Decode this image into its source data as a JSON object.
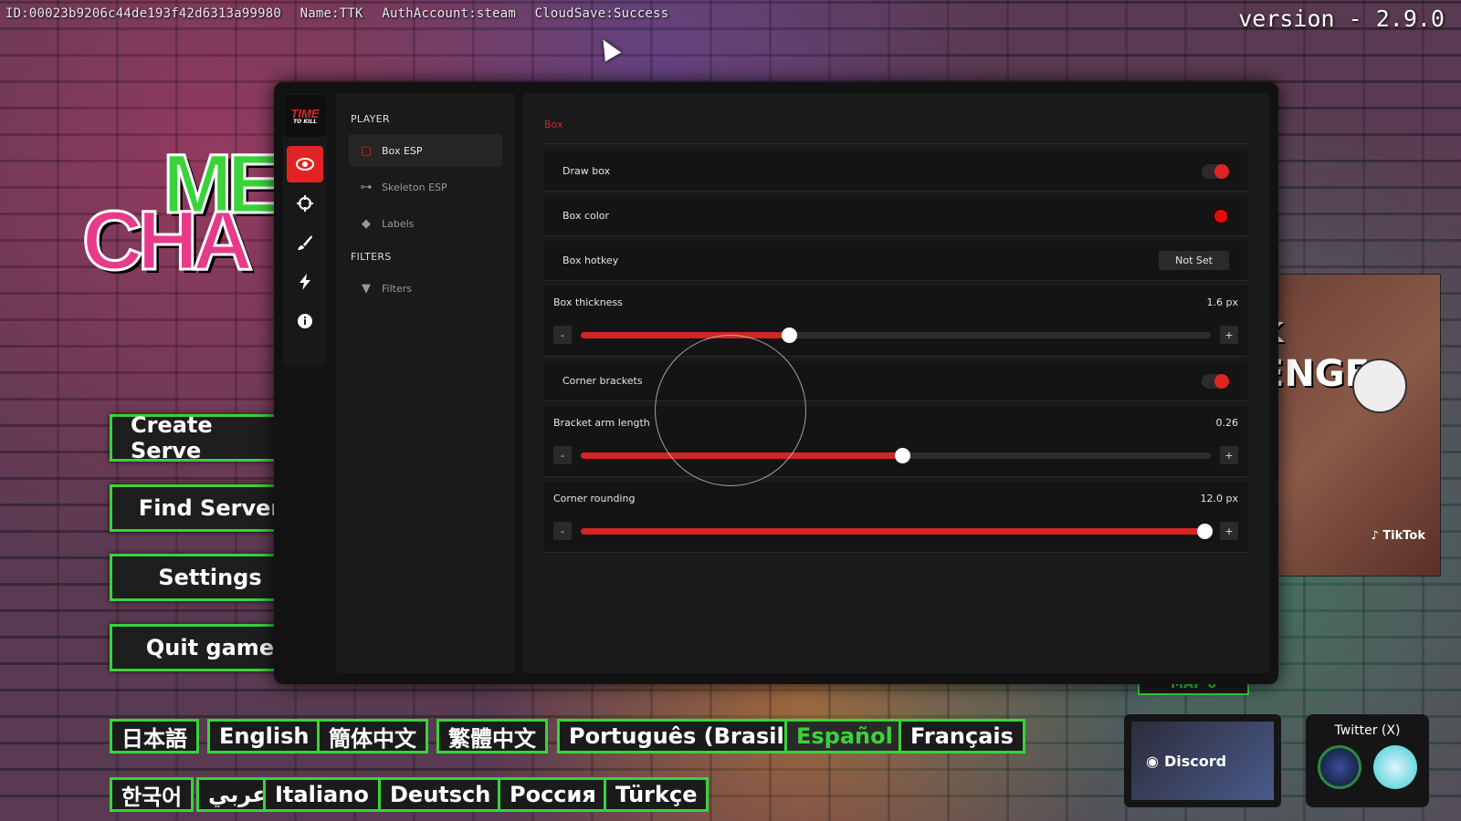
{
  "topbar": {
    "id": "ID:00023b9206c44de193f42d6313a99980",
    "name": "Name:TTK",
    "auth": "AuthAccount:steam",
    "cloud": "CloudSave:Success"
  },
  "version": "version - 2.9.0",
  "logo": {
    "line1": "ME",
    "line2": "CHA"
  },
  "main_menu": {
    "create": "Create Serve",
    "find": "Find Server",
    "settings": "Settings",
    "quit": "Quit game"
  },
  "languages_row1": [
    "日本語",
    "English",
    "簡体中文",
    "繁體中文",
    "Português (Brasil)",
    "Español",
    "Français"
  ],
  "languages_row2": [
    "한국어",
    "عربي",
    "Italiano",
    "Deutsch",
    "Россия",
    "Türkçe"
  ],
  "active_language": "Español",
  "promo": {
    "t1": "k",
    "t2": "ENGE",
    "tiktok": "TikTok"
  },
  "map_tab": "MAP 6",
  "discord": "Discord",
  "twitter": "Twitter (X)",
  "brand": {
    "line1": "TIME",
    "line2": "TO KILL"
  },
  "rail_icons": [
    "eye-icon",
    "crosshair-icon",
    "brush-icon",
    "bolt-icon",
    "info-icon"
  ],
  "sidebar": {
    "player_heading": "PLAYER",
    "items": [
      {
        "label": "Box ESP",
        "icon": "box-icon",
        "active": true
      },
      {
        "label": "Skeleton ESP",
        "icon": "bone-icon",
        "active": false
      },
      {
        "label": "Labels",
        "icon": "tag-icon",
        "active": false
      }
    ],
    "filters_heading": "FILTERS",
    "filter_items": [
      {
        "label": "Filters",
        "icon": "filter-icon"
      }
    ]
  },
  "content": {
    "section_title": "Box",
    "draw_box": {
      "label": "Draw box",
      "on": true
    },
    "box_color": {
      "label": "Box color",
      "color": "#e00e0e"
    },
    "box_hotkey": {
      "label": "Box hotkey",
      "value": "Not Set"
    },
    "box_thickness": {
      "label": "Box thickness",
      "value_text": "1.6 px",
      "fraction": 0.33
    },
    "corner_brackets": {
      "label": "Corner brackets",
      "on": true
    },
    "bracket_arm_length": {
      "label": "Bracket arm length",
      "value_text": "0.26",
      "fraction": 0.51
    },
    "corner_rounding": {
      "label": "Corner rounding",
      "value_text": "12.0 px",
      "fraction": 0.99
    }
  },
  "colors": {
    "accent": "#e02424",
    "menu_border": "#39d339"
  }
}
